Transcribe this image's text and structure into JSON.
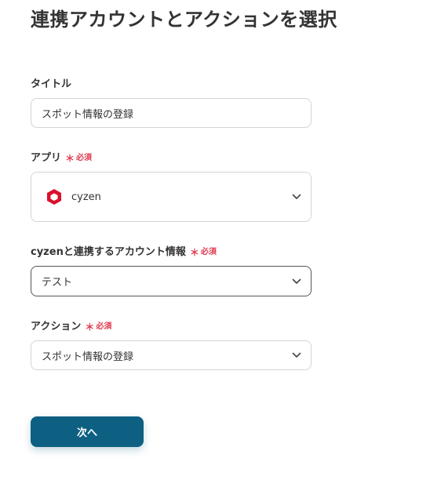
{
  "page": {
    "title": "連携アカウントとアクションを選択"
  },
  "fields": {
    "title": {
      "label": "タイトル",
      "value": "スポット情報の登録"
    },
    "app": {
      "label": "アプリ",
      "required_mark": "＊",
      "required_text": "必須",
      "value": "cyzen",
      "icon": "cyzen-logo-icon"
    },
    "account": {
      "label": "cyzenと連携するアカウント情報",
      "required_mark": "＊",
      "required_text": "必須",
      "value": "テスト"
    },
    "action": {
      "label": "アクション",
      "required_mark": "＊",
      "required_text": "必須",
      "value": "スポット情報の登録"
    }
  },
  "buttons": {
    "next_label": "次へ"
  },
  "colors": {
    "primary": "#0e6082",
    "required": "#e0394f",
    "app_logo": "#d9112b"
  }
}
